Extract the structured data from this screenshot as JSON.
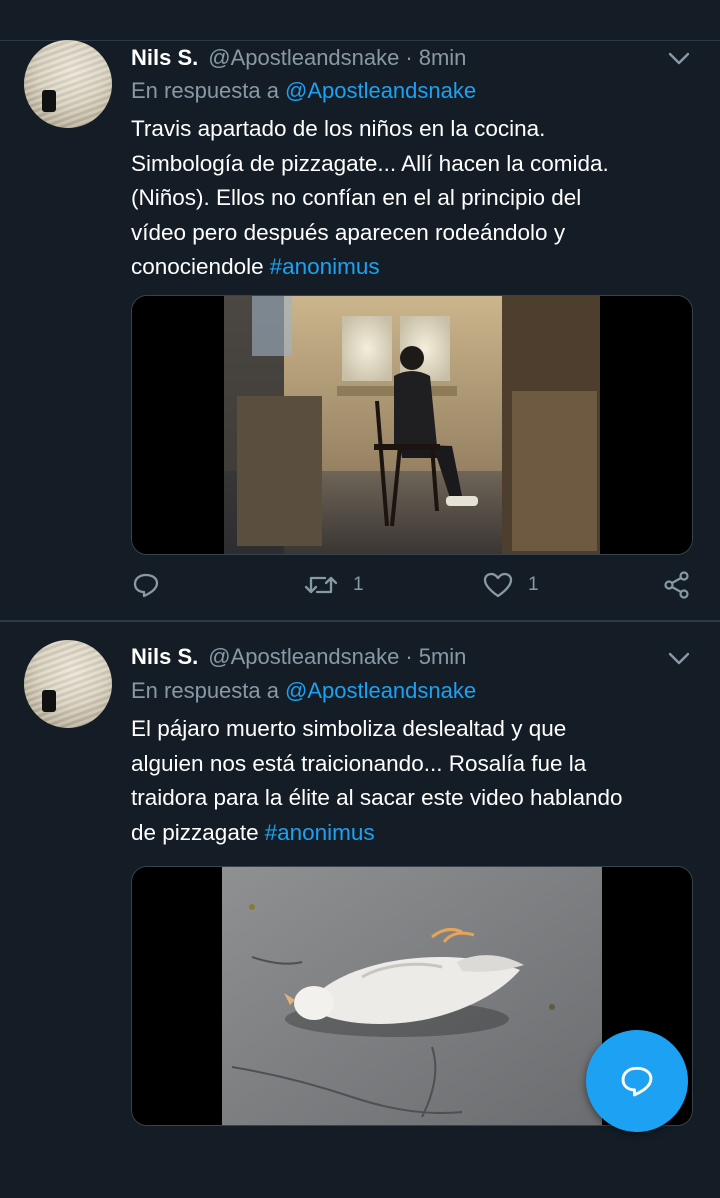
{
  "tweets": [
    {
      "author_name": "Nils S.",
      "handle": "@Apostleandsnake",
      "separator": "·",
      "time": "8min",
      "reply_prefix": "En respuesta a",
      "reply_mention": "@Apostleandsnake",
      "text_lines": [
        "Travis apartado de los niños en la cocina.",
        "Simbología de pizzagate... Allí hacen la comida.",
        "(Niños). Ellos no confían en el al principio del",
        "vídeo pero después aparecen rodeándolo y",
        "conociendole"
      ],
      "hashtag": "#anonimus",
      "retweets": "1",
      "likes": "1",
      "icons": [
        "chevron-down-icon",
        "reply-icon",
        "retweet-icon",
        "heart-icon",
        "share-icon"
      ]
    },
    {
      "author_name": "Nils S.",
      "handle": "@Apostleandsnake",
      "separator": "·",
      "time": "5min",
      "reply_prefix": "En respuesta a",
      "reply_mention": "@Apostleandsnake",
      "text_lines": [
        "El pájaro muerto simboliza deslealtad y que",
        "alguien nos está traicionando... Rosalía fue la",
        "traidora para la élite al sacar este video hablando",
        "de pizzagate"
      ],
      "hashtag": "#anonimus",
      "icons": [
        "chevron-down-icon"
      ]
    }
  ],
  "fab": {
    "icon": "compose-reply-icon"
  },
  "colors": {
    "background": "#141d26",
    "accent": "#1da1f2",
    "secondary_text": "#8899a6",
    "divider": "#2c3a47"
  }
}
